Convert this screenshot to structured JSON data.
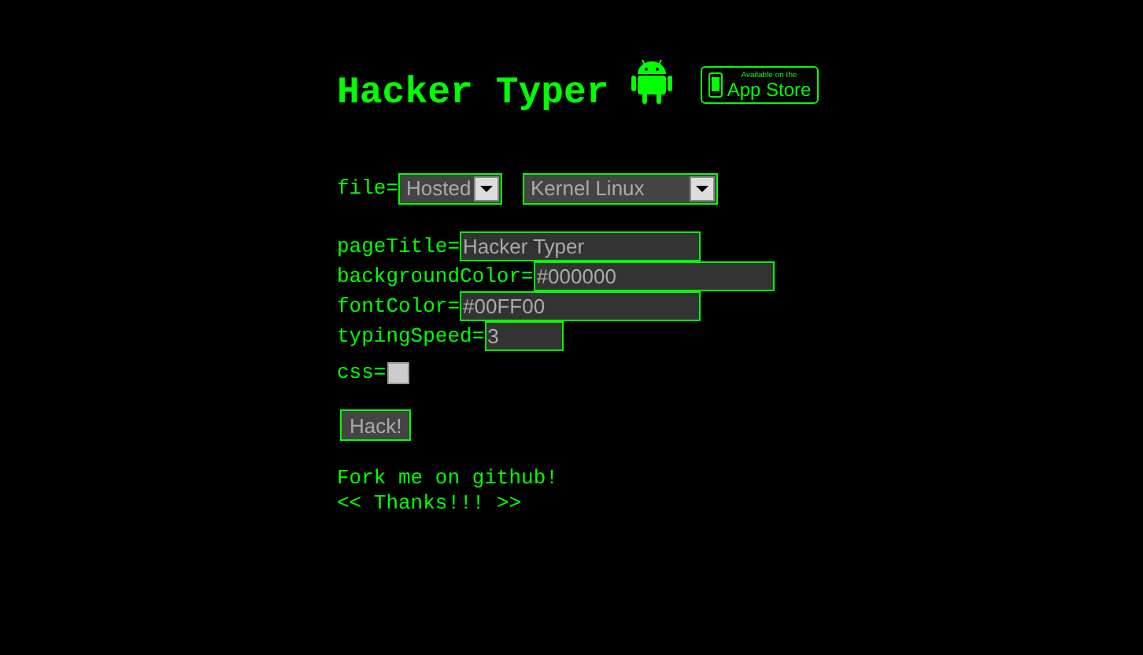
{
  "title": "Hacker Typer",
  "app_store_badge": {
    "small_text": "Available on the",
    "large_text": "App Store"
  },
  "file": {
    "label": "file=",
    "selects": [
      {
        "value": "Hosted"
      },
      {
        "value": "Kernel Linux"
      }
    ]
  },
  "fields": [
    {
      "kind": "text",
      "label": "pageTitle=",
      "value": "Hacker Typer"
    },
    {
      "kind": "text",
      "label": "backgroundColor=",
      "value": "#000000"
    },
    {
      "kind": "text",
      "label": "fontColor=",
      "value": "#00FF00"
    },
    {
      "kind": "text",
      "label": "typingSpeed=",
      "value": "3"
    },
    {
      "kind": "checkbox",
      "label": "css=",
      "checked": false
    }
  ],
  "button": "Hack!",
  "links": [
    "Fork me on github!",
    "<< Thanks!!! >>"
  ]
}
